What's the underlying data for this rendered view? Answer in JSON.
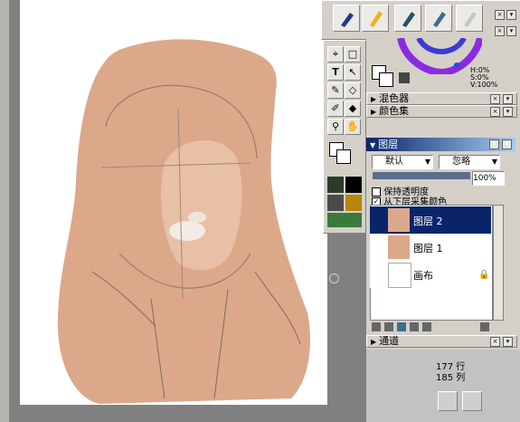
{
  "brushes": [
    "ink-pen-icon",
    "pencil-icon",
    "marker-icon",
    "watercolor-brush-icon",
    "airbrush-icon"
  ],
  "tools": [
    "lasso-icon",
    "rect-select-icon",
    "text-icon",
    "move-icon",
    "eyedropper-icon",
    "eraser-icon",
    "pen-icon",
    "fill-icon",
    "zoom-icon",
    "hand-icon"
  ],
  "color": {
    "hsv_h": "H:0%",
    "hsv_s": "S:0%",
    "hsv_v": "V:100%"
  },
  "panels": {
    "mixer_label": "混色器",
    "swatch_label": "颜色集",
    "layers_label": "图层",
    "channels_label": "通道"
  },
  "layers": {
    "blend_mode": "默认",
    "composite": "忽略",
    "opacity": "100%",
    "preserve_transparency": "保持透明度",
    "sample_below": "从下层采集颜色",
    "items": [
      {
        "name": "图层 2",
        "selected": true
      },
      {
        "name": "图层 1",
        "selected": false
      },
      {
        "name": "画布",
        "selected": false
      }
    ]
  },
  "navigator": {
    "row": "177 行",
    "col": "185 列"
  },
  "colors": {
    "skin": "#dba88a",
    "selection": "#0a246a",
    "panel": "#d4d0c8"
  }
}
